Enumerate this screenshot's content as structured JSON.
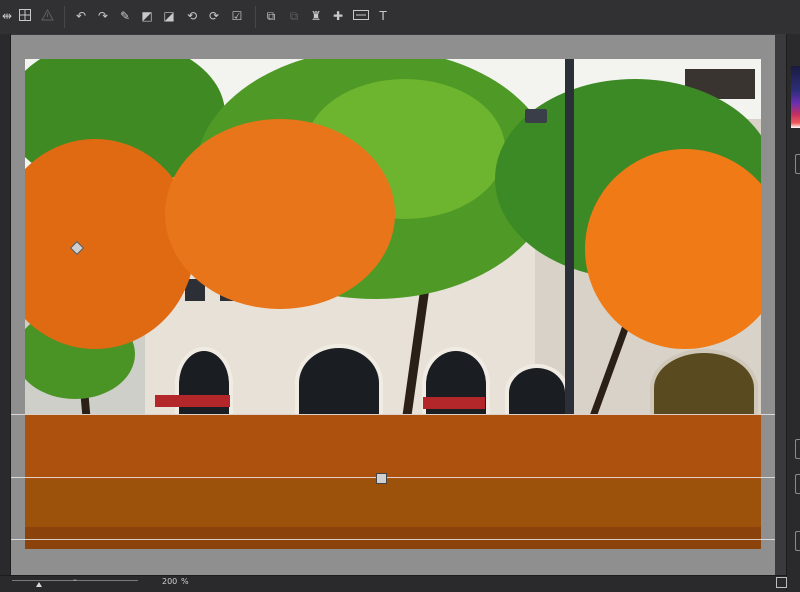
{
  "toolbar": {
    "icons": [
      "resize-arrows-icon",
      "grid-icon",
      "warning-icon",
      "undo-icon",
      "redo-icon",
      "brush-mask-icon",
      "gradient-mask-icon",
      "erase-mask-icon",
      "rotate-left-icon",
      "rotate-right-icon",
      "apply-mask-icon",
      "copy-mask-icon",
      "paste-mask-icon",
      "stamp-icon",
      "puzzle-icon",
      "crop-ratio-icon",
      "text-tool-icon"
    ]
  },
  "zoom": {
    "value": "200",
    "unit": "%",
    "level_fraction": 0.2
  },
  "mask_color": "#ff6a00",
  "accent": "#ff7a10"
}
